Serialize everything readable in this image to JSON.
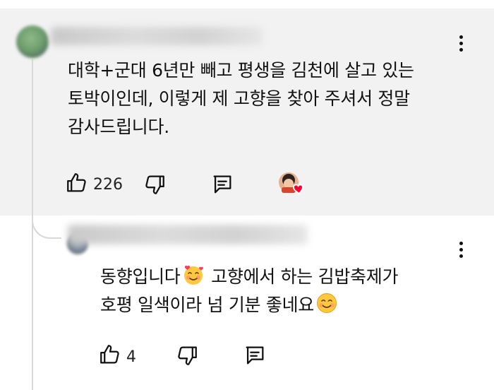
{
  "comment": {
    "text": "대학+군대 6년만 빼고 평생을 김천에 살고 있는\n토박이인데, 이렇게 제 고향을 찾아 주셔서 정말\n감사드립니다.",
    "like_count": "226",
    "icons": {
      "like": "thumbs-up-icon",
      "dislike": "thumbs-down-icon",
      "reply": "reply-comment-icon",
      "more": "more-vertical-icon",
      "creator_heart": "creator-heart-badge"
    }
  },
  "reply": {
    "line1_a": "동향입니다",
    "line1_b": " 고향에서 하는 김밥축제가",
    "line2": "호평 일색이라 넘 기분 좋네요",
    "like_count": "4",
    "emojis": [
      "smiling-face-with-hearts-emoji",
      "smiling-face-emoji"
    ]
  },
  "colors": {
    "highlight_bg": "#f2f2f2",
    "thread_line": "#d9d9d9",
    "heart": "#ff0033"
  }
}
